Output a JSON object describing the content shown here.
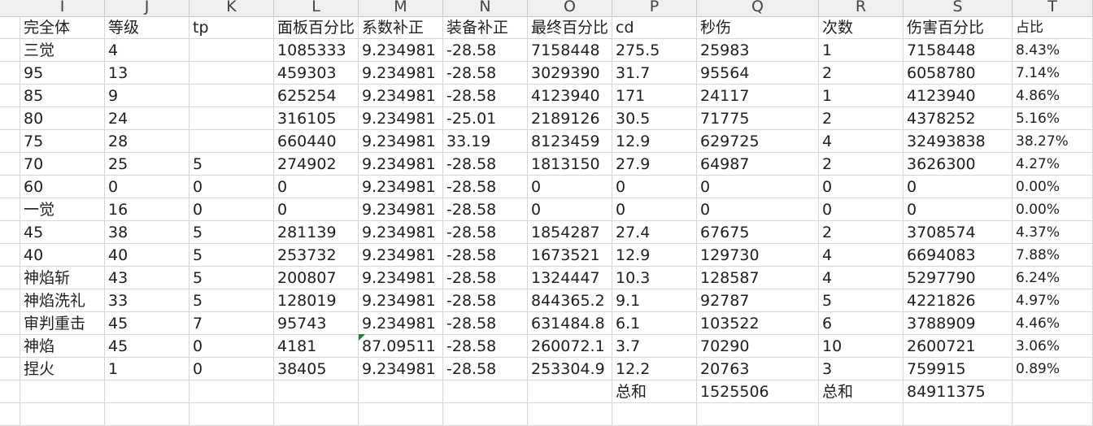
{
  "column_headers": [
    "I",
    "J",
    "K",
    "L",
    "M",
    "N",
    "O",
    "P",
    "Q",
    "R",
    "S",
    "T"
  ],
  "rows": [
    [
      "完全体",
      "等级",
      "tp",
      "面板百分比",
      "系数补正",
      "装备补正",
      "最终百分比",
      "cd",
      "秒伤",
      "次数",
      "伤害百分比",
      "占比"
    ],
    [
      "三觉",
      "4",
      "",
      "1085333",
      "9.234981",
      "-28.58",
      "7158448",
      "275.5",
      "25983",
      "1",
      "7158448",
      "8.43%"
    ],
    [
      "95",
      "13",
      "",
      "459303",
      "9.234981",
      "-28.58",
      "3029390",
      "31.7",
      "95564",
      "2",
      "6058780",
      "7.14%"
    ],
    [
      "85",
      "9",
      "",
      "625254",
      "9.234981",
      "-28.58",
      "4123940",
      "171",
      "24117",
      "1",
      "4123940",
      "4.86%"
    ],
    [
      "80",
      "24",
      "",
      "316105",
      "9.234981",
      "-25.01",
      "2189126",
      "30.5",
      "71775",
      "2",
      "4378252",
      "5.16%"
    ],
    [
      "75",
      "28",
      "",
      "660440",
      "9.234981",
      "33.19",
      "8123459",
      "12.9",
      "629725",
      "4",
      "32493838",
      "38.27%"
    ],
    [
      "70",
      "25",
      "5",
      "274902",
      "9.234981",
      "-28.58",
      "1813150",
      "27.9",
      "64987",
      "2",
      "3626300",
      "4.27%"
    ],
    [
      "60",
      "0",
      "0",
      "0",
      "9.234981",
      "-28.58",
      "0",
      "0",
      "0",
      "0",
      "0",
      "0.00%"
    ],
    [
      "一觉",
      "16",
      "0",
      "0",
      "9.234981",
      "-28.58",
      "0",
      "0",
      "0",
      "0",
      "0",
      "0.00%"
    ],
    [
      "45",
      "38",
      "5",
      "281139",
      "9.234981",
      "-28.58",
      "1854287",
      "27.4",
      "67675",
      "2",
      "3708574",
      "4.37%"
    ],
    [
      "40",
      "40",
      "5",
      "253732",
      "9.234981",
      "-28.58",
      "1673521",
      "12.9",
      "129730",
      "4",
      "6694083",
      "7.88%"
    ],
    [
      "神焰斩",
      "43",
      "5",
      "200807",
      "9.234981",
      "-28.58",
      "1324447",
      "10.3",
      "128587",
      "4",
      "5297790",
      "6.24%"
    ],
    [
      "神焰洗礼",
      "33",
      "5",
      "128019",
      "9.234981",
      "-28.58",
      "844365.2",
      "9.1",
      "92787",
      "5",
      "4221826",
      "4.97%"
    ],
    [
      "审判重击",
      "45",
      "7",
      "95743",
      "9.234981",
      "-28.58",
      "631484.8",
      "6.1",
      "103522",
      "6",
      "3788909",
      "4.46%"
    ],
    [
      "神焰",
      "45",
      "0",
      "4181",
      "87.09511",
      "-28.58",
      "260072.1",
      "3.7",
      "70290",
      "10",
      "2600721",
      "3.06%"
    ],
    [
      "捏火",
      "1",
      "0",
      "38405",
      "9.234981",
      "-28.58",
      "253304.9",
      "12.2",
      "20763",
      "3",
      "759915",
      "0.89%"
    ],
    [
      "",
      "",
      "",
      "",
      "",
      "",
      "",
      "总和",
      "1525506",
      "总和",
      "84911375",
      ""
    ],
    [
      "",
      "",
      "",
      "",
      "",
      "",
      "",
      "",
      "",
      "",
      "",
      ""
    ]
  ],
  "colors": {
    "header_bg": "#efefef",
    "grid_line": "#d6d6d6",
    "comment_marker": "#1a7f37"
  }
}
